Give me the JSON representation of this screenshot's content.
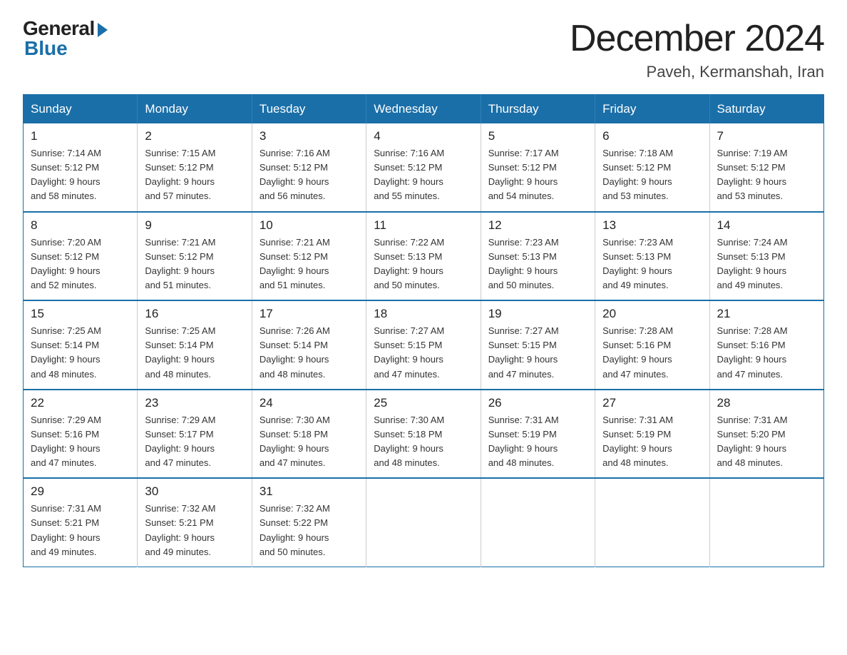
{
  "header": {
    "logo_general": "General",
    "logo_blue": "Blue",
    "month_title": "December 2024",
    "location": "Paveh, Kermanshah, Iran"
  },
  "days_of_week": [
    "Sunday",
    "Monday",
    "Tuesday",
    "Wednesday",
    "Thursday",
    "Friday",
    "Saturday"
  ],
  "weeks": [
    [
      {
        "day": "1",
        "sunrise": "7:14 AM",
        "sunset": "5:12 PM",
        "daylight": "9 hours and 58 minutes."
      },
      {
        "day": "2",
        "sunrise": "7:15 AM",
        "sunset": "5:12 PM",
        "daylight": "9 hours and 57 minutes."
      },
      {
        "day": "3",
        "sunrise": "7:16 AM",
        "sunset": "5:12 PM",
        "daylight": "9 hours and 56 minutes."
      },
      {
        "day": "4",
        "sunrise": "7:16 AM",
        "sunset": "5:12 PM",
        "daylight": "9 hours and 55 minutes."
      },
      {
        "day": "5",
        "sunrise": "7:17 AM",
        "sunset": "5:12 PM",
        "daylight": "9 hours and 54 minutes."
      },
      {
        "day": "6",
        "sunrise": "7:18 AM",
        "sunset": "5:12 PM",
        "daylight": "9 hours and 53 minutes."
      },
      {
        "day": "7",
        "sunrise": "7:19 AM",
        "sunset": "5:12 PM",
        "daylight": "9 hours and 53 minutes."
      }
    ],
    [
      {
        "day": "8",
        "sunrise": "7:20 AM",
        "sunset": "5:12 PM",
        "daylight": "9 hours and 52 minutes."
      },
      {
        "day": "9",
        "sunrise": "7:21 AM",
        "sunset": "5:12 PM",
        "daylight": "9 hours and 51 minutes."
      },
      {
        "day": "10",
        "sunrise": "7:21 AM",
        "sunset": "5:12 PM",
        "daylight": "9 hours and 51 minutes."
      },
      {
        "day": "11",
        "sunrise": "7:22 AM",
        "sunset": "5:13 PM",
        "daylight": "9 hours and 50 minutes."
      },
      {
        "day": "12",
        "sunrise": "7:23 AM",
        "sunset": "5:13 PM",
        "daylight": "9 hours and 50 minutes."
      },
      {
        "day": "13",
        "sunrise": "7:23 AM",
        "sunset": "5:13 PM",
        "daylight": "9 hours and 49 minutes."
      },
      {
        "day": "14",
        "sunrise": "7:24 AM",
        "sunset": "5:13 PM",
        "daylight": "9 hours and 49 minutes."
      }
    ],
    [
      {
        "day": "15",
        "sunrise": "7:25 AM",
        "sunset": "5:14 PM",
        "daylight": "9 hours and 48 minutes."
      },
      {
        "day": "16",
        "sunrise": "7:25 AM",
        "sunset": "5:14 PM",
        "daylight": "9 hours and 48 minutes."
      },
      {
        "day": "17",
        "sunrise": "7:26 AM",
        "sunset": "5:14 PM",
        "daylight": "9 hours and 48 minutes."
      },
      {
        "day": "18",
        "sunrise": "7:27 AM",
        "sunset": "5:15 PM",
        "daylight": "9 hours and 47 minutes."
      },
      {
        "day": "19",
        "sunrise": "7:27 AM",
        "sunset": "5:15 PM",
        "daylight": "9 hours and 47 minutes."
      },
      {
        "day": "20",
        "sunrise": "7:28 AM",
        "sunset": "5:16 PM",
        "daylight": "9 hours and 47 minutes."
      },
      {
        "day": "21",
        "sunrise": "7:28 AM",
        "sunset": "5:16 PM",
        "daylight": "9 hours and 47 minutes."
      }
    ],
    [
      {
        "day": "22",
        "sunrise": "7:29 AM",
        "sunset": "5:16 PM",
        "daylight": "9 hours and 47 minutes."
      },
      {
        "day": "23",
        "sunrise": "7:29 AM",
        "sunset": "5:17 PM",
        "daylight": "9 hours and 47 minutes."
      },
      {
        "day": "24",
        "sunrise": "7:30 AM",
        "sunset": "5:18 PM",
        "daylight": "9 hours and 47 minutes."
      },
      {
        "day": "25",
        "sunrise": "7:30 AM",
        "sunset": "5:18 PM",
        "daylight": "9 hours and 48 minutes."
      },
      {
        "day": "26",
        "sunrise": "7:31 AM",
        "sunset": "5:19 PM",
        "daylight": "9 hours and 48 minutes."
      },
      {
        "day": "27",
        "sunrise": "7:31 AM",
        "sunset": "5:19 PM",
        "daylight": "9 hours and 48 minutes."
      },
      {
        "day": "28",
        "sunrise": "7:31 AM",
        "sunset": "5:20 PM",
        "daylight": "9 hours and 48 minutes."
      }
    ],
    [
      {
        "day": "29",
        "sunrise": "7:31 AM",
        "sunset": "5:21 PM",
        "daylight": "9 hours and 49 minutes."
      },
      {
        "day": "30",
        "sunrise": "7:32 AM",
        "sunset": "5:21 PM",
        "daylight": "9 hours and 49 minutes."
      },
      {
        "day": "31",
        "sunrise": "7:32 AM",
        "sunset": "5:22 PM",
        "daylight": "9 hours and 50 minutes."
      },
      null,
      null,
      null,
      null
    ]
  ],
  "labels": {
    "sunrise": "Sunrise:",
    "sunset": "Sunset:",
    "daylight": "Daylight:"
  }
}
